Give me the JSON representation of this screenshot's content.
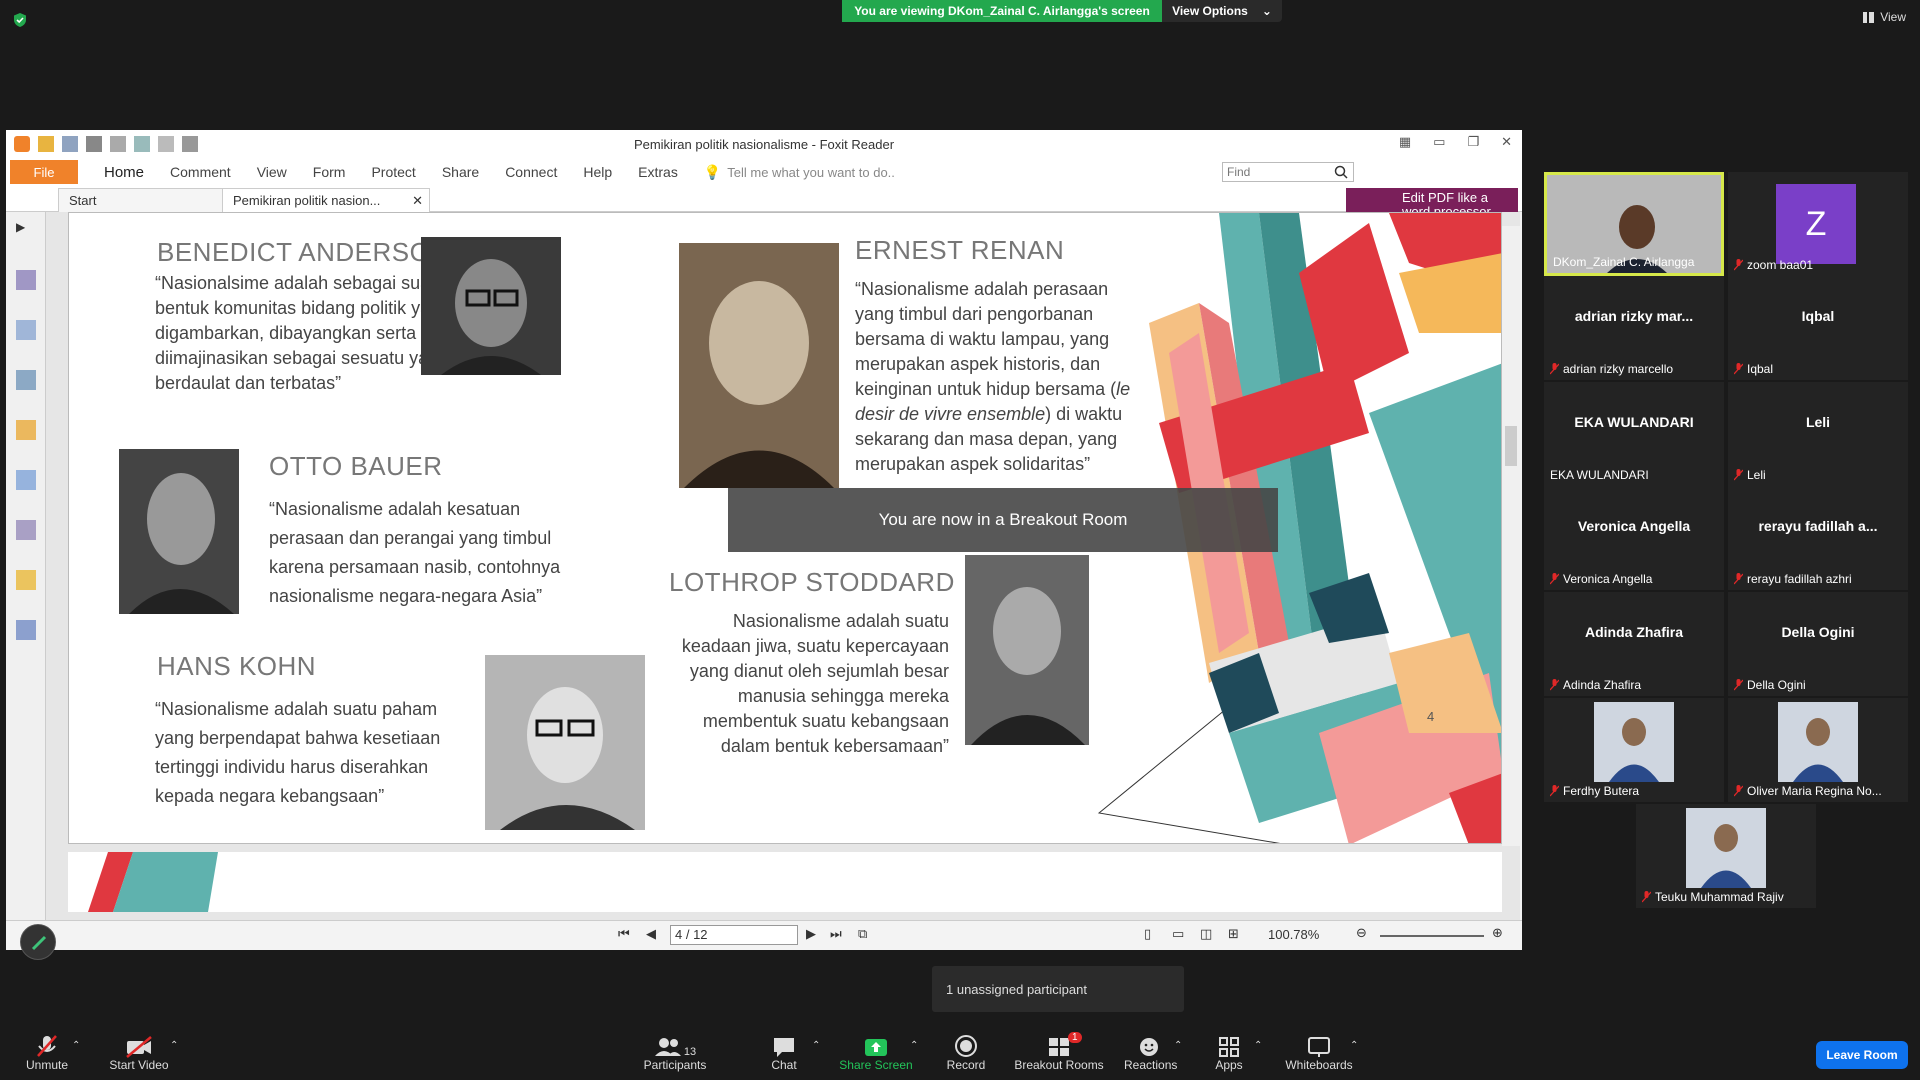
{
  "security_icon": "shield-check-icon",
  "banner": {
    "viewing": "You are viewing DKom_Zainal C. Airlangga's screen",
    "options": "View Options"
  },
  "top_right": {
    "view": "View"
  },
  "foxit": {
    "title": "Pemikiran politik nasionalisme - Foxit Reader",
    "menu": [
      "File",
      "Home",
      "Comment",
      "View",
      "Form",
      "Protect",
      "Share",
      "Connect",
      "Help",
      "Extras"
    ],
    "tell_me": "Tell me what you want to do..",
    "find_placeholder": "Find",
    "tabs": [
      "Start",
      "Pemikiran politik nasion..."
    ],
    "edit_pdf": "Edit PDF like a word processor",
    "page_field": "4 / 12",
    "zoom": "100.78%"
  },
  "slide": {
    "page_number": "4",
    "people": [
      {
        "name": "BENEDICT ANDERSON",
        "quote": "“Nasionalsime adalah sebagai suatu bentuk komunitas bidang politik yang digambarkan, dibayangkan serta diimajinasikan sebagai sesuatu yang berdaulat dan terbatas”"
      },
      {
        "name": "OTTO BAUER",
        "quote": "“Nasionalisme adalah kesatuan perasaan dan perangai yang timbul karena persamaan nasib, contohnya nasionalisme negara-negara Asia”"
      },
      {
        "name": "HANS KOHN",
        "quote": "“Nasionalisme adalah suatu paham yang berpendapat bahwa kesetiaan tertinggi individu harus diserahkan kepada negara kebangsaan”"
      },
      {
        "name": "ERNEST RENAN",
        "quote_a": "“Nasionalisme adalah perasaan yang timbul dari pengorbanan bersama di waktu lampau, yang merupakan aspek historis, dan keinginan untuk hidup bersama (",
        "quote_em": "le desir de vivre ensemble",
        "quote_b": ") di waktu sekarang dan masa depan, yang merupakan aspek solidaritas”"
      },
      {
        "name": "LOTHROP STODDARD",
        "quote": "Nasionalisme adalah suatu keadaan jiwa, suatu kepercayaan yang dianut oleh sejumlah besar manusia sehingga mereka membentuk suatu kebangsaan dalam bentuk kebersamaan”"
      }
    ]
  },
  "toast": "You are now in a Breakout Room",
  "gallery": [
    {
      "big": "",
      "label": "DKom_Zainal C. Airlangga",
      "muted": false,
      "type": "video"
    },
    {
      "big": "Z",
      "label": "zoom baa01",
      "muted": true,
      "type": "avatar"
    },
    {
      "big": "adrian rizky mar...",
      "label": "adrian rizky marcello",
      "muted": true
    },
    {
      "big": "Iqbal",
      "label": "Iqbal",
      "muted": true
    },
    {
      "big": "EKA WULANDARI",
      "label": "EKA WULANDARI",
      "muted": false
    },
    {
      "big": "Leli",
      "label": "Leli",
      "muted": true
    },
    {
      "big": "Veronica Angella",
      "label": "Veronica Angella",
      "muted": true
    },
    {
      "big": "rerayu fadillah a...",
      "label": "rerayu fadillah azhri",
      "muted": true
    },
    {
      "big": "Adinda Zhafira",
      "label": "Adinda Zhafira",
      "muted": true
    },
    {
      "big": "Della Ogini",
      "label": "Della Ogini",
      "muted": true
    },
    {
      "big": "",
      "label": "Ferdhy Butera",
      "muted": true,
      "type": "photo"
    },
    {
      "big": "",
      "label": "Oliver Maria Regina No...",
      "muted": true,
      "type": "photo"
    },
    {
      "big": "",
      "label": "Teuku Muhammad Rajiv",
      "muted": true,
      "type": "photo"
    }
  ],
  "unassigned": "1 unassigned participant",
  "bottom": {
    "unmute": "Unmute",
    "start_video": "Start Video",
    "participants": "Participants",
    "participants_count": "13",
    "chat": "Chat",
    "share_screen": "Share Screen",
    "record": "Record",
    "breakout_rooms": "Breakout Rooms",
    "breakout_badge": "1",
    "reactions": "Reactions",
    "apps": "Apps",
    "whiteboards": "Whiteboards",
    "leave": "Leave Room"
  },
  "colors": {
    "accent_green": "#23a84e",
    "leave_blue": "#0e72ed",
    "foxit_orange": "#f0822a",
    "active_speaker": "#d6e84a"
  }
}
